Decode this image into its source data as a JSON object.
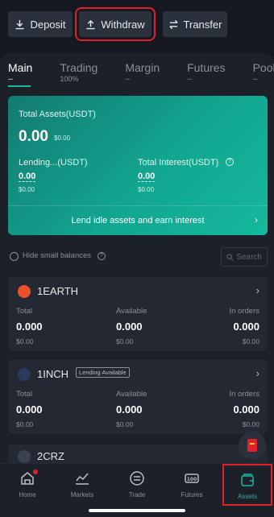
{
  "actions": {
    "deposit_label": "Deposit",
    "withdraw_label": "Withdraw",
    "transfer_label": "Transfer"
  },
  "tabs": [
    {
      "label": "Main",
      "sub": "--"
    },
    {
      "label": "Trading",
      "sub": "100%"
    },
    {
      "label": "Margin",
      "sub": "--"
    },
    {
      "label": "Futures",
      "sub": "--"
    },
    {
      "label": "Pool-",
      "sub": "--"
    }
  ],
  "summary": {
    "total_assets_label": "Total Assets(USDT)",
    "total_assets_value": "0.00",
    "total_assets_usd": "$0.00",
    "lending_label": "Lending...(USDT)",
    "lending_value": "0.00",
    "lending_usd": "$0.00",
    "interest_label": "Total Interest(USDT)",
    "interest_value": "0.00",
    "interest_usd": "$0.00",
    "lend_cta": "Lend idle assets and earn interest"
  },
  "filter": {
    "hide_small_label": "Hide small balances",
    "search_placeholder": "Search"
  },
  "columns": {
    "total": "Total",
    "available": "Available",
    "in_orders": "In orders"
  },
  "assets": [
    {
      "name": "1EARTH",
      "badge": "",
      "total": "0.000",
      "total_usd": "$0.00",
      "available": "0.000",
      "available_usd": "$0.00",
      "in_orders": "0.000",
      "in_orders_usd": "$0.00"
    },
    {
      "name": "1INCH",
      "badge": "Lending Available",
      "total": "0.000",
      "total_usd": "$0.00",
      "available": "0.000",
      "available_usd": "$0.00",
      "in_orders": "0.000",
      "in_orders_usd": "$0.00"
    },
    {
      "name": "2CRZ",
      "badge": ""
    }
  ],
  "nav": [
    {
      "label": "Home",
      "icon": "home-icon"
    },
    {
      "label": "Markets",
      "icon": "markets-icon"
    },
    {
      "label": "Trade",
      "icon": "trade-icon"
    },
    {
      "label": "Futures",
      "icon": "futures-icon"
    },
    {
      "label": "Assets",
      "icon": "wallet-icon"
    }
  ],
  "colors": {
    "accent": "#1fb69f",
    "highlight": "#e0202a",
    "background": "#151820"
  }
}
